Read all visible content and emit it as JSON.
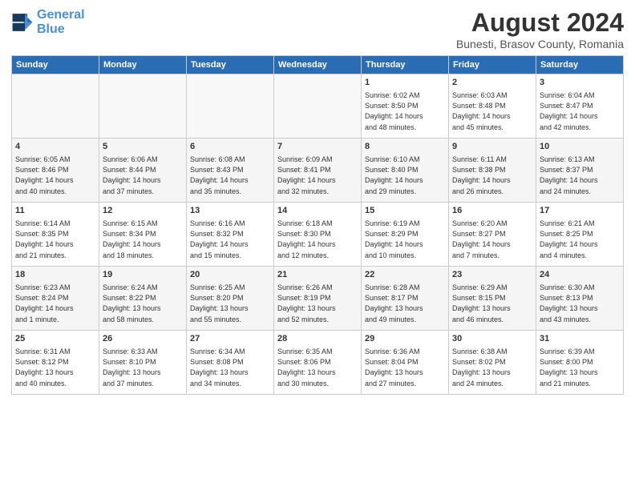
{
  "logo": {
    "line1": "General",
    "line2": "Blue"
  },
  "title": "August 2024",
  "subtitle": "Bunesti, Brasov County, Romania",
  "weekdays": [
    "Sunday",
    "Monday",
    "Tuesday",
    "Wednesday",
    "Thursday",
    "Friday",
    "Saturday"
  ],
  "weeks": [
    [
      {
        "day": "",
        "info": ""
      },
      {
        "day": "",
        "info": ""
      },
      {
        "day": "",
        "info": ""
      },
      {
        "day": "",
        "info": ""
      },
      {
        "day": "1",
        "info": "Sunrise: 6:02 AM\nSunset: 8:50 PM\nDaylight: 14 hours\nand 48 minutes."
      },
      {
        "day": "2",
        "info": "Sunrise: 6:03 AM\nSunset: 8:48 PM\nDaylight: 14 hours\nand 45 minutes."
      },
      {
        "day": "3",
        "info": "Sunrise: 6:04 AM\nSunset: 8:47 PM\nDaylight: 14 hours\nand 42 minutes."
      }
    ],
    [
      {
        "day": "4",
        "info": "Sunrise: 6:05 AM\nSunset: 8:46 PM\nDaylight: 14 hours\nand 40 minutes."
      },
      {
        "day": "5",
        "info": "Sunrise: 6:06 AM\nSunset: 8:44 PM\nDaylight: 14 hours\nand 37 minutes."
      },
      {
        "day": "6",
        "info": "Sunrise: 6:08 AM\nSunset: 8:43 PM\nDaylight: 14 hours\nand 35 minutes."
      },
      {
        "day": "7",
        "info": "Sunrise: 6:09 AM\nSunset: 8:41 PM\nDaylight: 14 hours\nand 32 minutes."
      },
      {
        "day": "8",
        "info": "Sunrise: 6:10 AM\nSunset: 8:40 PM\nDaylight: 14 hours\nand 29 minutes."
      },
      {
        "day": "9",
        "info": "Sunrise: 6:11 AM\nSunset: 8:38 PM\nDaylight: 14 hours\nand 26 minutes."
      },
      {
        "day": "10",
        "info": "Sunrise: 6:13 AM\nSunset: 8:37 PM\nDaylight: 14 hours\nand 24 minutes."
      }
    ],
    [
      {
        "day": "11",
        "info": "Sunrise: 6:14 AM\nSunset: 8:35 PM\nDaylight: 14 hours\nand 21 minutes."
      },
      {
        "day": "12",
        "info": "Sunrise: 6:15 AM\nSunset: 8:34 PM\nDaylight: 14 hours\nand 18 minutes."
      },
      {
        "day": "13",
        "info": "Sunrise: 6:16 AM\nSunset: 8:32 PM\nDaylight: 14 hours\nand 15 minutes."
      },
      {
        "day": "14",
        "info": "Sunrise: 6:18 AM\nSunset: 8:30 PM\nDaylight: 14 hours\nand 12 minutes."
      },
      {
        "day": "15",
        "info": "Sunrise: 6:19 AM\nSunset: 8:29 PM\nDaylight: 14 hours\nand 10 minutes."
      },
      {
        "day": "16",
        "info": "Sunrise: 6:20 AM\nSunset: 8:27 PM\nDaylight: 14 hours\nand 7 minutes."
      },
      {
        "day": "17",
        "info": "Sunrise: 6:21 AM\nSunset: 8:25 PM\nDaylight: 14 hours\nand 4 minutes."
      }
    ],
    [
      {
        "day": "18",
        "info": "Sunrise: 6:23 AM\nSunset: 8:24 PM\nDaylight: 14 hours\nand 1 minute."
      },
      {
        "day": "19",
        "info": "Sunrise: 6:24 AM\nSunset: 8:22 PM\nDaylight: 13 hours\nand 58 minutes."
      },
      {
        "day": "20",
        "info": "Sunrise: 6:25 AM\nSunset: 8:20 PM\nDaylight: 13 hours\nand 55 minutes."
      },
      {
        "day": "21",
        "info": "Sunrise: 6:26 AM\nSunset: 8:19 PM\nDaylight: 13 hours\nand 52 minutes."
      },
      {
        "day": "22",
        "info": "Sunrise: 6:28 AM\nSunset: 8:17 PM\nDaylight: 13 hours\nand 49 minutes."
      },
      {
        "day": "23",
        "info": "Sunrise: 6:29 AM\nSunset: 8:15 PM\nDaylight: 13 hours\nand 46 minutes."
      },
      {
        "day": "24",
        "info": "Sunrise: 6:30 AM\nSunset: 8:13 PM\nDaylight: 13 hours\nand 43 minutes."
      }
    ],
    [
      {
        "day": "25",
        "info": "Sunrise: 6:31 AM\nSunset: 8:12 PM\nDaylight: 13 hours\nand 40 minutes."
      },
      {
        "day": "26",
        "info": "Sunrise: 6:33 AM\nSunset: 8:10 PM\nDaylight: 13 hours\nand 37 minutes."
      },
      {
        "day": "27",
        "info": "Sunrise: 6:34 AM\nSunset: 8:08 PM\nDaylight: 13 hours\nand 34 minutes."
      },
      {
        "day": "28",
        "info": "Sunrise: 6:35 AM\nSunset: 8:06 PM\nDaylight: 13 hours\nand 30 minutes."
      },
      {
        "day": "29",
        "info": "Sunrise: 6:36 AM\nSunset: 8:04 PM\nDaylight: 13 hours\nand 27 minutes."
      },
      {
        "day": "30",
        "info": "Sunrise: 6:38 AM\nSunset: 8:02 PM\nDaylight: 13 hours\nand 24 minutes."
      },
      {
        "day": "31",
        "info": "Sunrise: 6:39 AM\nSunset: 8:00 PM\nDaylight: 13 hours\nand 21 minutes."
      }
    ]
  ]
}
